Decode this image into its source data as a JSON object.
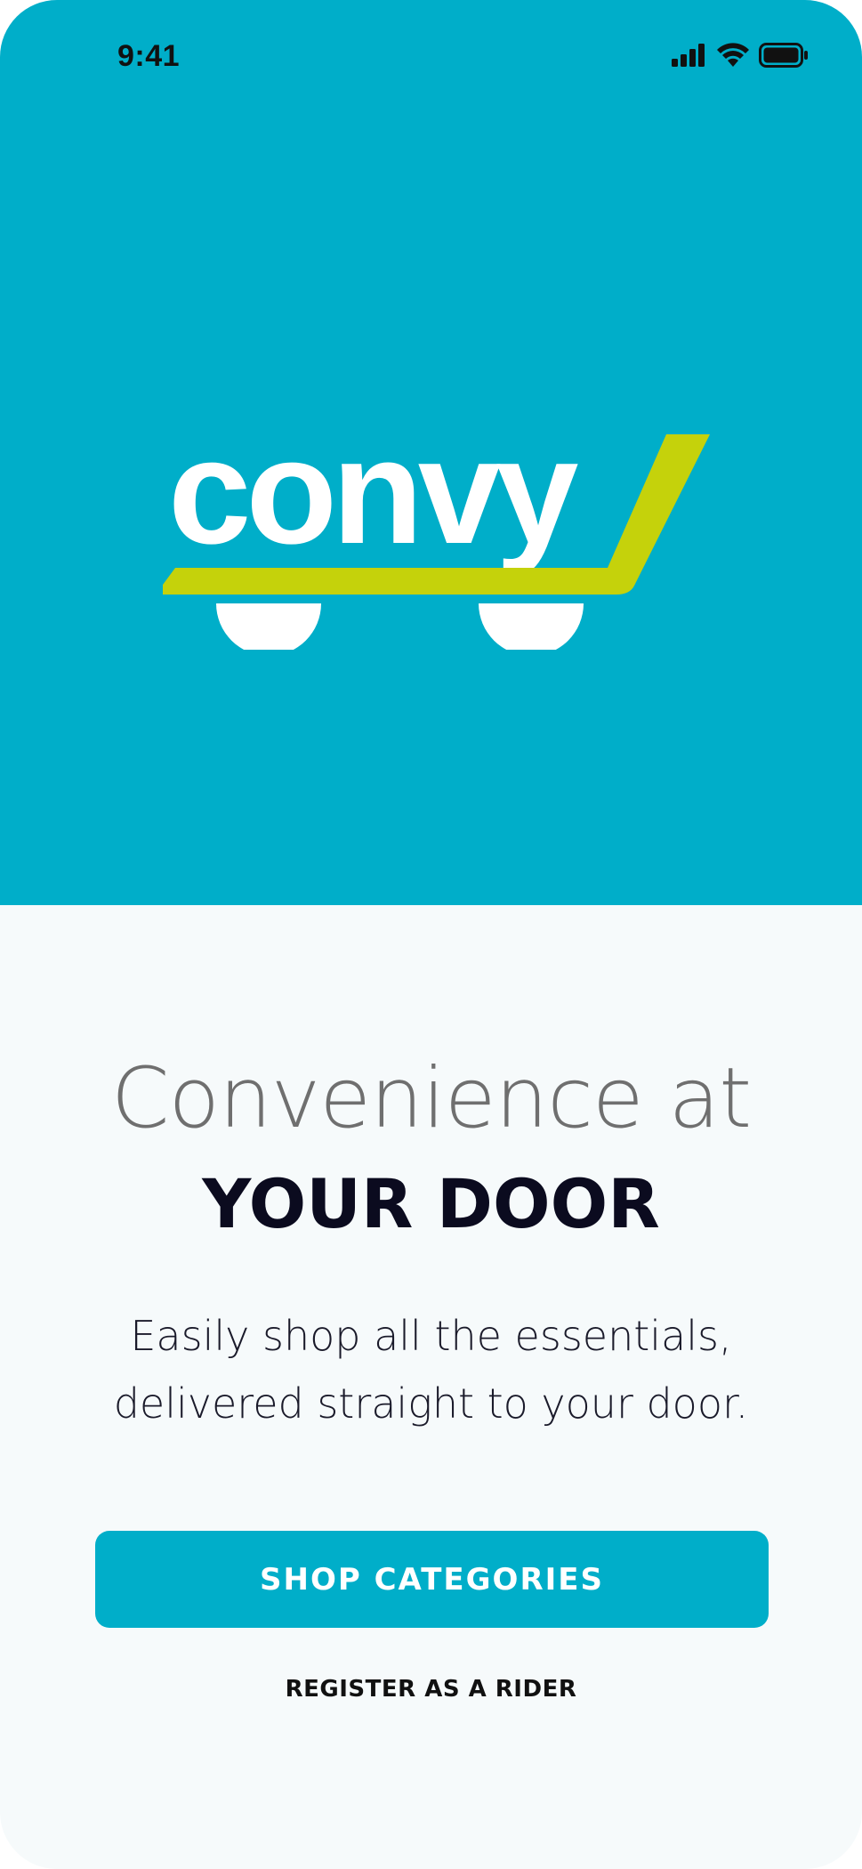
{
  "status_bar": {
    "time": "9:41",
    "icons": [
      "cellular-signal-icon",
      "wifi-icon",
      "battery-icon"
    ]
  },
  "brand": {
    "logo_text": "convy",
    "logo_accent_letter": "y",
    "colors": {
      "primary": "#00aec9",
      "accent": "#c5d20b",
      "background": "#f6fafb",
      "logo_text": "#ffffff"
    }
  },
  "hero": {
    "headline": "Convenience at",
    "headline_emphasis": "YOUR DOOR",
    "subtitle_line1": "Easily shop all the essentials,",
    "subtitle_line2": "delivered straight to your door."
  },
  "actions": {
    "primary_label": "SHOP CATEGORIES",
    "secondary_label": "REGISTER AS A RIDER"
  }
}
